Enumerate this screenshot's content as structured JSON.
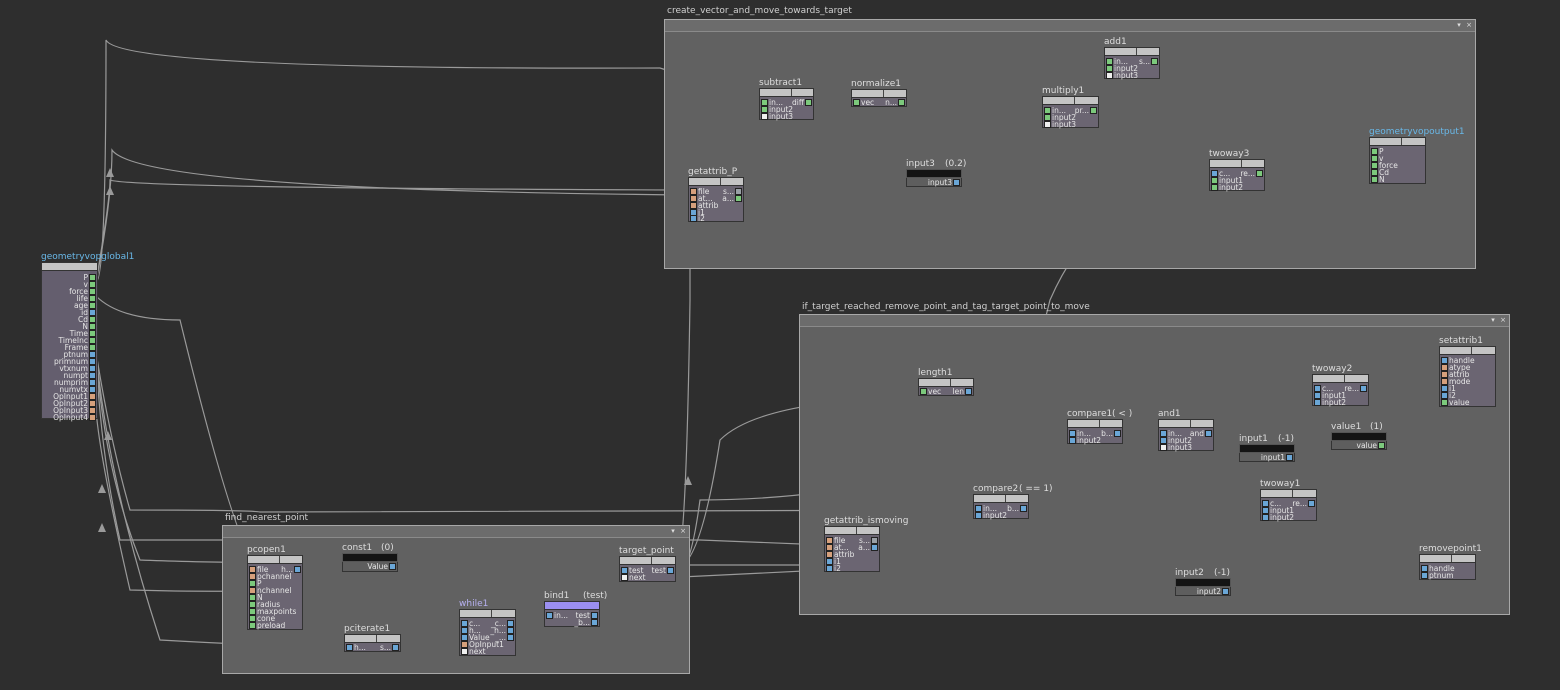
{
  "boxes": {
    "create": {
      "title": "create_vector_and_move_towards_target",
      "pin": "▾",
      "close": "×"
    },
    "iftarget": {
      "title": "if_target_reached_remove_point_and_tag_target_point_to_move",
      "pin": "▾",
      "close": "×"
    },
    "find": {
      "title": "find_nearest_point",
      "pin": "▾",
      "close": "×"
    }
  },
  "nodes": {
    "global": {
      "name": "geometryvopglobal1",
      "outputs": [
        "P",
        "v",
        "force",
        "life",
        "age",
        "id",
        "Cd",
        "N",
        "Time",
        "TimeInc",
        "Frame",
        "ptnum",
        "primnum",
        "vtxnum",
        "numpt",
        "numprim",
        "numvtx",
        "OpInput1",
        "OpInput2",
        "OpInput3",
        "OpInput4"
      ]
    },
    "subtract1": {
      "name": "subtract1",
      "ports": [
        "in...",
        "input2",
        "input3"
      ],
      "out": "diff"
    },
    "normalize1": {
      "name": "normalize1",
      "in": "vec",
      "out": "n..."
    },
    "add1": {
      "name": "add1",
      "ports": [
        "in...",
        "input2",
        "input3"
      ],
      "out": "s..."
    },
    "multiply1": {
      "name": "multiply1",
      "ports": [
        "in...",
        "input2",
        "input3"
      ],
      "out": "pr..."
    },
    "getattrib_P": {
      "name": "getattrib_P",
      "ports": [
        "file",
        "at...",
        "attrib",
        "i1",
        "i2"
      ],
      "out1": "s...",
      "out2": "a..."
    },
    "input3": {
      "name": "input3",
      "parm": "(0.2)",
      "out": "input3"
    },
    "twoway3": {
      "name": "twoway3",
      "ports": [
        "c...",
        "input1",
        "input2"
      ],
      "out": "re..."
    },
    "geoout": {
      "name": "geometryvopoutput1",
      "ports": [
        "P",
        "v",
        "force",
        "Cd",
        "N"
      ]
    },
    "length1": {
      "name": "length1",
      "in": "vec",
      "out": "len"
    },
    "compare1": {
      "name": "compare1",
      "parm": "( < )",
      "ports": [
        "in...",
        "input2"
      ],
      "out": "b..."
    },
    "and1": {
      "name": "and1",
      "ports": [
        "in...",
        "input2",
        "input3"
      ],
      "out": "and"
    },
    "twoway2": {
      "name": "twoway2",
      "ports": [
        "c...",
        "input1",
        "input2"
      ],
      "out": "re..."
    },
    "setattrib1": {
      "name": "setattrib1",
      "ports": [
        "handle",
        "atype",
        "attrib",
        "mode",
        "i1",
        "i2",
        "value"
      ]
    },
    "input1": {
      "name": "input1",
      "parm": "(-1)",
      "out": "input1"
    },
    "value1": {
      "name": "value1",
      "parm": "(1)",
      "out": "value"
    },
    "compare2": {
      "name": "compare2",
      "parm": "( == 1)",
      "ports": [
        "in...",
        "input2"
      ],
      "out": "b..."
    },
    "getattrib_ismoving": {
      "name": "getattrib_ismoving",
      "ports": [
        "file",
        "at...",
        "attrib",
        "i1",
        "i2"
      ],
      "out1": "s...",
      "out2": "a..."
    },
    "twoway1": {
      "name": "twoway1",
      "ports": [
        "c...",
        "input1",
        "input2"
      ],
      "out": "re..."
    },
    "removepoint1": {
      "name": "removepoint1",
      "ports": [
        "handle",
        "ptnum"
      ]
    },
    "input2": {
      "name": "input2",
      "parm": "(-1)",
      "out": "input2"
    },
    "pcopen1": {
      "name": "pcopen1",
      "ports": [
        "file",
        "pchannel",
        "P",
        "nchannel",
        "N",
        "radius",
        "maxpoints",
        "cone",
        "preload"
      ],
      "out": "h..."
    },
    "const1": {
      "name": "const1",
      "parm": "(0)",
      "out": "Value"
    },
    "pciterate1": {
      "name": "pciterate1",
      "in": "h...",
      "out": "s..."
    },
    "while1": {
      "name": "while1",
      "ports": [
        "c...",
        "h...",
        "Value",
        "OpInput1",
        "next"
      ],
      "outs": [
        "_c...",
        "_h...",
        "_..."
      ]
    },
    "bind1": {
      "name": "bind1",
      "parm": "(test)",
      "in": "in...",
      "outs": [
        "test",
        "_b..."
      ]
    },
    "target_point": {
      "name": "target_point",
      "ports": [
        "test",
        "next"
      ],
      "out": "test"
    }
  },
  "colors": {
    "background": "#2e2e2e",
    "box": "#616161",
    "node_body": "#6b6572",
    "wire": "#9a9a9a",
    "blue_name": "#69b8e8"
  }
}
